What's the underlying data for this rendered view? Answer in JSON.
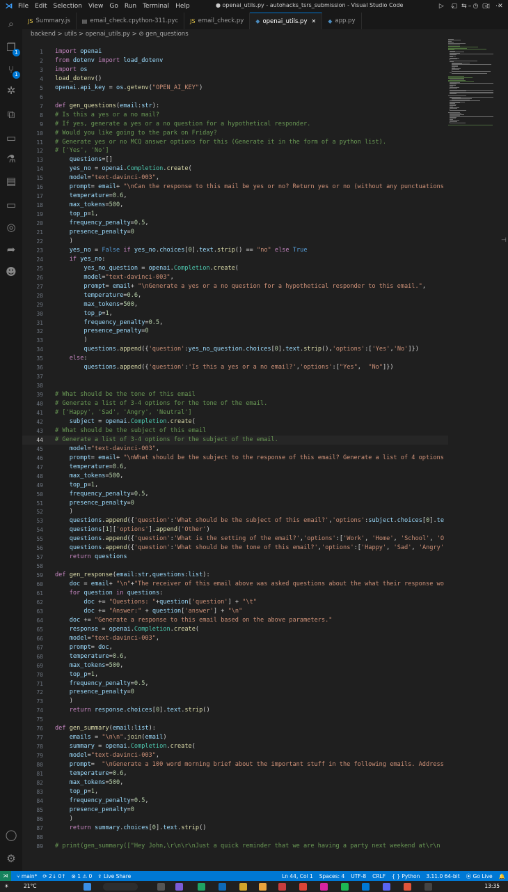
{
  "titlebar": {
    "menu": [
      "File",
      "Edit",
      "Selection",
      "View",
      "Go",
      "Run",
      "Terminal",
      "Help"
    ],
    "title": "● openai_utils.py - autohacks_tsrs_submission - Visual Studio Code"
  },
  "tabs": [
    {
      "icon": "JS",
      "label": "Summary.js",
      "active": false
    },
    {
      "icon": "▤",
      "label": "email_check.cpython-311.pyc",
      "active": false
    },
    {
      "icon": "JS",
      "label": "email_check.py",
      "active": false
    },
    {
      "icon": "◆",
      "label": "openai_utils.py",
      "active": true
    },
    {
      "icon": "◆",
      "label": "app.py",
      "active": false
    }
  ],
  "breadcrumb": "backend > utils > openai_utils.py > ⊘ gen_questions",
  "activity_badges": {
    "explorer": "1",
    "source_control": "1"
  },
  "code_lines": [
    {
      "n": 1,
      "t": "import openai"
    },
    {
      "n": 2,
      "t": "from dotenv import load_dotenv"
    },
    {
      "n": 3,
      "t": "import os"
    },
    {
      "n": 4,
      "t": "load_dotenv()"
    },
    {
      "n": 5,
      "t": "openai.api_key = os.getenv(\"OPEN_AI_KEY\")"
    },
    {
      "n": 6,
      "t": ""
    },
    {
      "n": 7,
      "t": "def gen_questions(email:str):"
    },
    {
      "n": 8,
      "t": "# Is this a yes or a no mail?"
    },
    {
      "n": 9,
      "t": "# If yes, generate a yes or a no question for a hypothetical responder."
    },
    {
      "n": 10,
      "t": "# Would you like going to the park on Friday?"
    },
    {
      "n": 11,
      "t": "# Generate yes or no MCQ answer options for this (Generate it in the form of a python list)."
    },
    {
      "n": 12,
      "t": "# ['Yes', 'No']"
    },
    {
      "n": 13,
      "t": "    questions=[]"
    },
    {
      "n": 14,
      "t": "    yes_no = openai.Completion.create("
    },
    {
      "n": 15,
      "t": "    model=\"text-davinci-003\","
    },
    {
      "n": 16,
      "t": "    prompt= email+ \"\\nCan the response to this mail be yes or no? Return yes or no (without any punctuations"
    },
    {
      "n": 17,
      "t": "    temperature=0.6,"
    },
    {
      "n": 18,
      "t": "    max_tokens=500,"
    },
    {
      "n": 19,
      "t": "    top_p=1,"
    },
    {
      "n": 20,
      "t": "    frequency_penalty=0.5,"
    },
    {
      "n": 21,
      "t": "    presence_penalty=0"
    },
    {
      "n": 22,
      "t": "    )"
    },
    {
      "n": 23,
      "t": "    yes_no = False if yes_no.choices[0].text.strip() == \"no\" else True"
    },
    {
      "n": 24,
      "t": "    if yes_no:"
    },
    {
      "n": 25,
      "t": "        yes_no_question = openai.Completion.create("
    },
    {
      "n": 26,
      "t": "        model=\"text-davinci-003\","
    },
    {
      "n": 27,
      "t": "        prompt= email+ \"\\nGenerate a yes or a no question for a hypothetical responder to this email.\","
    },
    {
      "n": 28,
      "t": "        temperature=0.6,"
    },
    {
      "n": 29,
      "t": "        max_tokens=500,"
    },
    {
      "n": 30,
      "t": "        top_p=1,"
    },
    {
      "n": 31,
      "t": "        frequency_penalty=0.5,"
    },
    {
      "n": 32,
      "t": "        presence_penalty=0"
    },
    {
      "n": 33,
      "t": "        )"
    },
    {
      "n": 34,
      "t": "        questions.append({'question':yes_no_question.choices[0].text.strip(),'options':['Yes','No']})"
    },
    {
      "n": 35,
      "t": "    else:"
    },
    {
      "n": 36,
      "t": "        questions.append({'question':'Is this a yes or a no email?','options':[\"Yes\",  \"No\"]})"
    },
    {
      "n": 37,
      "t": ""
    },
    {
      "n": 38,
      "t": ""
    },
    {
      "n": 39,
      "t": "# What should be the tone of this email"
    },
    {
      "n": 40,
      "t": "# Generate a list of 3-4 options for the tone of the email."
    },
    {
      "n": 41,
      "t": "# ['Happy', 'Sad', 'Angry', 'Neutral']"
    },
    {
      "n": 42,
      "t": "    subject = openai.Completion.create("
    },
    {
      "n": 43,
      "t": "# What should be the subject of this email"
    },
    {
      "n": 44,
      "t": "# Generate a list of 3-4 options for the subject of the email."
    },
    {
      "n": 45,
      "t": "    model=\"text-davinci-003\","
    },
    {
      "n": 46,
      "t": "    prompt= email+ \"\\nWhat should be the subject to the response of this email? Generate a list of 4 options"
    },
    {
      "n": 47,
      "t": "    temperature=0.6,"
    },
    {
      "n": 48,
      "t": "    max_tokens=500,"
    },
    {
      "n": 49,
      "t": "    top_p=1,"
    },
    {
      "n": 50,
      "t": "    frequency_penalty=0.5,"
    },
    {
      "n": 51,
      "t": "    presence_penalty=0"
    },
    {
      "n": 52,
      "t": "    )"
    },
    {
      "n": 53,
      "t": "    questions.append({'question':'What should be the subject of this email?','options':subject.choices[0].te"
    },
    {
      "n": 54,
      "t": "    questions[1]['options'].append('Other')"
    },
    {
      "n": 55,
      "t": "    questions.append({'question':'What is the setting of the email?','options':['Work', 'Home', 'School', 'O"
    },
    {
      "n": 56,
      "t": "    questions.append({'question':'What should be the tone of this email?','options':['Happy', 'Sad', 'Angry'"
    },
    {
      "n": 57,
      "t": "    return questions"
    },
    {
      "n": 58,
      "t": ""
    },
    {
      "n": 59,
      "t": "def gen_response(email:str,questions:list):"
    },
    {
      "n": 60,
      "t": "    doc = email+ \"\\n\"+\"The receiver of this email above was asked questions about the what their response wo"
    },
    {
      "n": 61,
      "t": "    for question in questions:"
    },
    {
      "n": 62,
      "t": "        doc += \"Questions: \"+question['question'] + \"\\t\""
    },
    {
      "n": 63,
      "t": "        doc += \"Answer:\" + question['answer'] + \"\\n\""
    },
    {
      "n": 64,
      "t": "    doc += \"Generate a response to this email based on the above parameters.\""
    },
    {
      "n": 65,
      "t": "    response = openai.Completion.create("
    },
    {
      "n": 66,
      "t": "    model=\"text-davinci-003\","
    },
    {
      "n": 67,
      "t": "    prompt= doc,"
    },
    {
      "n": 68,
      "t": "    temperature=0.6,"
    },
    {
      "n": 69,
      "t": "    max_tokens=500,"
    },
    {
      "n": 70,
      "t": "    top_p=1,"
    },
    {
      "n": 71,
      "t": "    frequency_penalty=0.5,"
    },
    {
      "n": 72,
      "t": "    presence_penalty=0"
    },
    {
      "n": 73,
      "t": "    )"
    },
    {
      "n": 74,
      "t": "    return response.choices[0].text.strip()"
    },
    {
      "n": 75,
      "t": ""
    },
    {
      "n": 76,
      "t": "def gen_summary(email:list):"
    },
    {
      "n": 77,
      "t": "    emails = \"\\n\\n\".join(email)"
    },
    {
      "n": 78,
      "t": "    summary = openai.Completion.create("
    },
    {
      "n": 79,
      "t": "    model=\"text-davinci-003\","
    },
    {
      "n": 80,
      "t": "    prompt=  \"\\nGenerate a 100 word morning brief about the important stuff in the following emails. Address"
    },
    {
      "n": 81,
      "t": "    temperature=0.6,"
    },
    {
      "n": 82,
      "t": "    max_tokens=500,"
    },
    {
      "n": 83,
      "t": "    top_p=1,"
    },
    {
      "n": 84,
      "t": "    frequency_penalty=0.5,"
    },
    {
      "n": 85,
      "t": "    presence_penalty=0"
    },
    {
      "n": 86,
      "t": "    )"
    },
    {
      "n": 87,
      "t": "    return summary.choices[0].text.strip()"
    },
    {
      "n": 88,
      "t": ""
    },
    {
      "n": 89,
      "t": "# print(gen_summary([\"Hey John,\\r\\n\\r\\nJust a quick reminder that we are having a party next weekend at\\r\\n"
    }
  ],
  "current_line": 44,
  "status": {
    "branch": "main*",
    "sync": "⟳ 2↓ 0↑",
    "problems": "⊗ 1 ⚠ 0",
    "live_share": "Live Share",
    "position": "Ln 44, Col 1",
    "spaces": "Spaces: 4",
    "encoding": "UTF-8",
    "eol": "CRLF",
    "language": "Python",
    "interpreter": "3.11.0 64-bit",
    "go_live": "Go Live"
  },
  "taskbar": {
    "weather": "21°C",
    "time": "13:35"
  },
  "colors": {
    "accent": "#0078d4",
    "editor_bg": "#1f1f1f",
    "keyword": "#c586c0",
    "string": "#ce9178",
    "comment": "#6a9955",
    "function": "#dcdcaa"
  }
}
